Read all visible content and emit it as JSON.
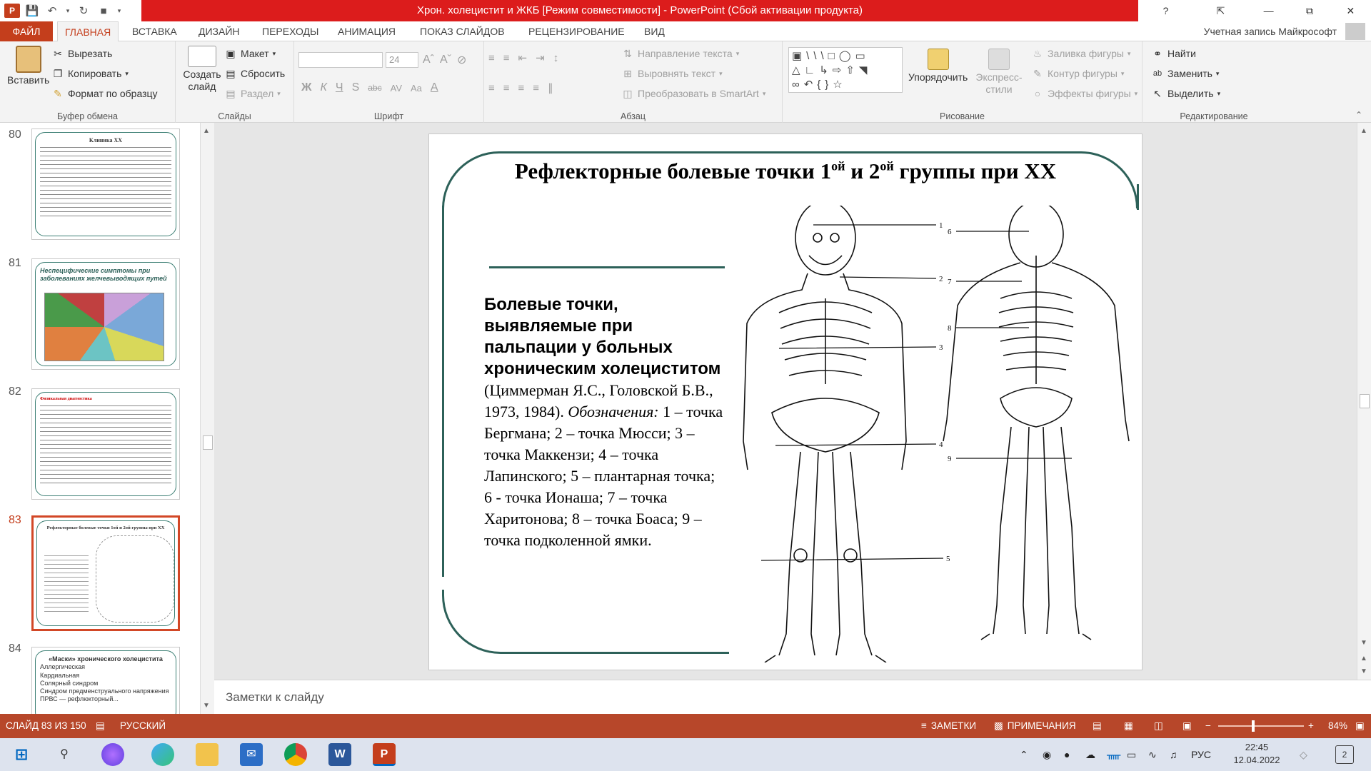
{
  "window": {
    "title": "Хрон. холецистит и ЖКБ [Режим совместимости] - PowerPoint (Сбой активации продукта)",
    "help": "?"
  },
  "tabs": {
    "file": "ФАЙЛ",
    "items": [
      "ГЛАВНАЯ",
      "ВСТАВКА",
      "ДИЗАЙН",
      "ПЕРЕХОДЫ",
      "АНИМАЦИЯ",
      "ПОКАЗ СЛАЙДОВ",
      "РЕЦЕНЗИРОВАНИЕ",
      "ВИД"
    ],
    "account": "Учетная запись Майкрософт"
  },
  "ribbon": {
    "clipboard": {
      "paste": "Вставить",
      "cut": "Вырезать",
      "copy": "Копировать",
      "format": "Формат по образцу",
      "label": "Буфер обмена"
    },
    "slides": {
      "new": "Создать слайд",
      "layout": "Макет",
      "reset": "Сбросить",
      "section": "Раздел",
      "label": "Слайды"
    },
    "font": {
      "size": "24",
      "label": "Шрифт"
    },
    "paragraph": {
      "direction": "Направление текста",
      "align": "Выровнять текст",
      "smartart": "Преобразовать в SmartArt",
      "label": "Абзац"
    },
    "drawing": {
      "arrange": "Упорядочить",
      "styles": "Экспресс-стили",
      "fill": "Заливка фигуры",
      "outline": "Контур фигуры",
      "effects": "Эффекты фигуры",
      "label": "Рисование"
    },
    "editing": {
      "find": "Найти",
      "replace": "Заменить",
      "select": "Выделить",
      "label": "Редактирование"
    }
  },
  "thumbs": [
    {
      "num": "80",
      "title": "Клиника ХХ"
    },
    {
      "num": "81",
      "title": "Неспецифические симптомы при заболеваниях желчевыводящих путей"
    },
    {
      "num": "82",
      "title": "Физикальная диагностика"
    },
    {
      "num": "83",
      "title": "Рефлекторные болевые точки 1ой и 2ой группы при ХХ"
    },
    {
      "num": "84",
      "title": "«Маски» хронического холецистита"
    }
  ],
  "thumb84": [
    "Аллергическая",
    "Кардиальная",
    "Солярный синдром",
    "Синдром предменструального напряжения",
    "ПРВС — рефлюкторный..."
  ],
  "slide": {
    "title_main": "Рефлекторные болевые точки 1",
    "title_sup1": "ой",
    "title_mid": " и 2",
    "title_sup2": "ой",
    "title_end": " группы при ХХ",
    "bold_text": "Болевые точки, выявляемые при пальпации у больных хроническим холециститом",
    "text_a": " (Циммерман Я.С., Головской Б.В., 1973, 1984). ",
    "text_italic": "Обозначения:",
    "text_b": " 1 – точка Бергмана;  2 – точка Мюсси; 3 – точка Маккензи; 4 – точка Лапинского; 5 – плантарная точка; 6 - точка Ионаша; 7 – точка Харитонова; 8 – точка Боаса; 9 – точка подколенной ямки.",
    "points": [
      "1",
      "2",
      "3",
      "4",
      "5",
      "6",
      "7",
      "8",
      "9"
    ]
  },
  "notes": {
    "placeholder": "Заметки к слайду"
  },
  "status": {
    "slide": "СЛАЙД 83 ИЗ 150",
    "lang": "РУССКИЙ",
    "notes": "ЗАМЕТКИ",
    "comments": "ПРИМЕЧАНИЯ",
    "zoom": "84%",
    "zoom_value": 84
  },
  "taskbar": {
    "lang": "РУС",
    "time": "22:45",
    "date": "12.04.2022",
    "notif": "2"
  },
  "colors": {
    "accent": "#b7472a",
    "frame": "#2d6159",
    "title": "#dc1c1c"
  }
}
